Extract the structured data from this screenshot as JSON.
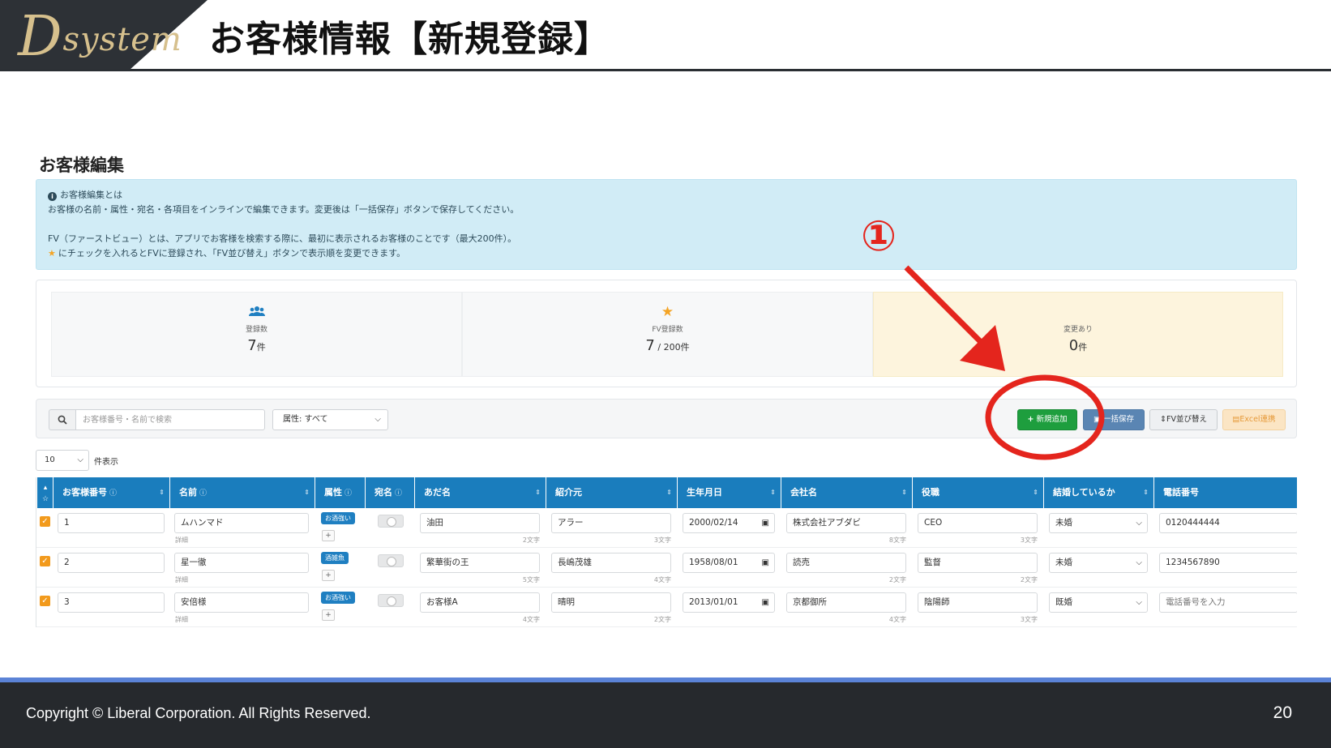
{
  "logo": {
    "text_initial": "D",
    "text_rest": "system"
  },
  "slide_title": "お客様情報【新規登録】",
  "section_title": "お客様編集",
  "info": {
    "heading": "お客様編集とは",
    "line1": "お客様の名前・属性・宛名・各項目をインラインで編集できます。変更後は「一括保存」ボタンで保存してください。",
    "line2": "FV（ファーストビュー）とは、アプリでお客様を検索する際に、最初に表示されるお客様のことです（最大200件）。",
    "line3": "にチェックを入れるとFVに登録され、「FV並び替え」ボタンで表示順を変更できます。"
  },
  "stats": {
    "registered": {
      "label": "登録数",
      "value": "7",
      "unit": "件"
    },
    "fv": {
      "label": "FV登録数",
      "value": "7",
      "max": " / 200",
      "unit": "件"
    },
    "changes": {
      "label": "変更あり",
      "value": "0",
      "unit": "件"
    }
  },
  "toolbar": {
    "search_placeholder": "お客様番号・名前で検索",
    "attr_select": "属性: すべて",
    "add_button": "新規追加",
    "save_button": "一括保存",
    "sort_button": "FV並び替え",
    "excel_button": "Excel連携"
  },
  "per_page": {
    "value": "10",
    "label": "件表示"
  },
  "table": {
    "headers": [
      "お客様番号",
      "名前",
      "属性",
      "宛名",
      "あだ名",
      "紹介元",
      "生年月日",
      "会社名",
      "役職",
      "結婚しているか",
      "電話番号"
    ],
    "detail_label": "詳細",
    "rows": [
      {
        "no": "1",
        "name": "ムハンマド",
        "attr": "お酒強い",
        "nick": "油田",
        "nick_cnt": "2文字",
        "ref": "アラー",
        "ref_cnt": "3文字",
        "birth": "2000/02/14",
        "company": "株式会社アブダビ",
        "company_cnt": "8文字",
        "title": "CEO",
        "title_cnt": "3文字",
        "married": "未婚",
        "phone": "0120444444"
      },
      {
        "no": "2",
        "name": "星一徹",
        "attr": "酒雑魚",
        "nick": "繁華街の王",
        "nick_cnt": "5文字",
        "ref": "長嶋茂雄",
        "ref_cnt": "4文字",
        "birth": "1958/08/01",
        "company": "読売",
        "company_cnt": "2文字",
        "title": "監督",
        "title_cnt": "2文字",
        "married": "未婚",
        "phone": "1234567890"
      },
      {
        "no": "3",
        "name": "安倍様",
        "attr": "お酒強い",
        "nick": "お客様A",
        "nick_cnt": "4文字",
        "ref": "晴明",
        "ref_cnt": "2文字",
        "birth": "2013/01/01",
        "company": "京都御所",
        "company_cnt": "4文字",
        "title": "陰陽師",
        "title_cnt": "3文字",
        "married": "既婚",
        "phone_placeholder": "電話番号を入力"
      }
    ]
  },
  "annotation": {
    "number": "①",
    "color": "#e4251d"
  },
  "footer": {
    "copyright": "Copyright ©  Liberal Corporation. All Rights Reserved.",
    "page": "20"
  },
  "colors": {
    "header_dark": "#2d3136",
    "table_header": "#1a7dbd",
    "add_green": "#1e9e3e",
    "footer_bg": "#26292d",
    "footer_line": "#5b83d6"
  }
}
